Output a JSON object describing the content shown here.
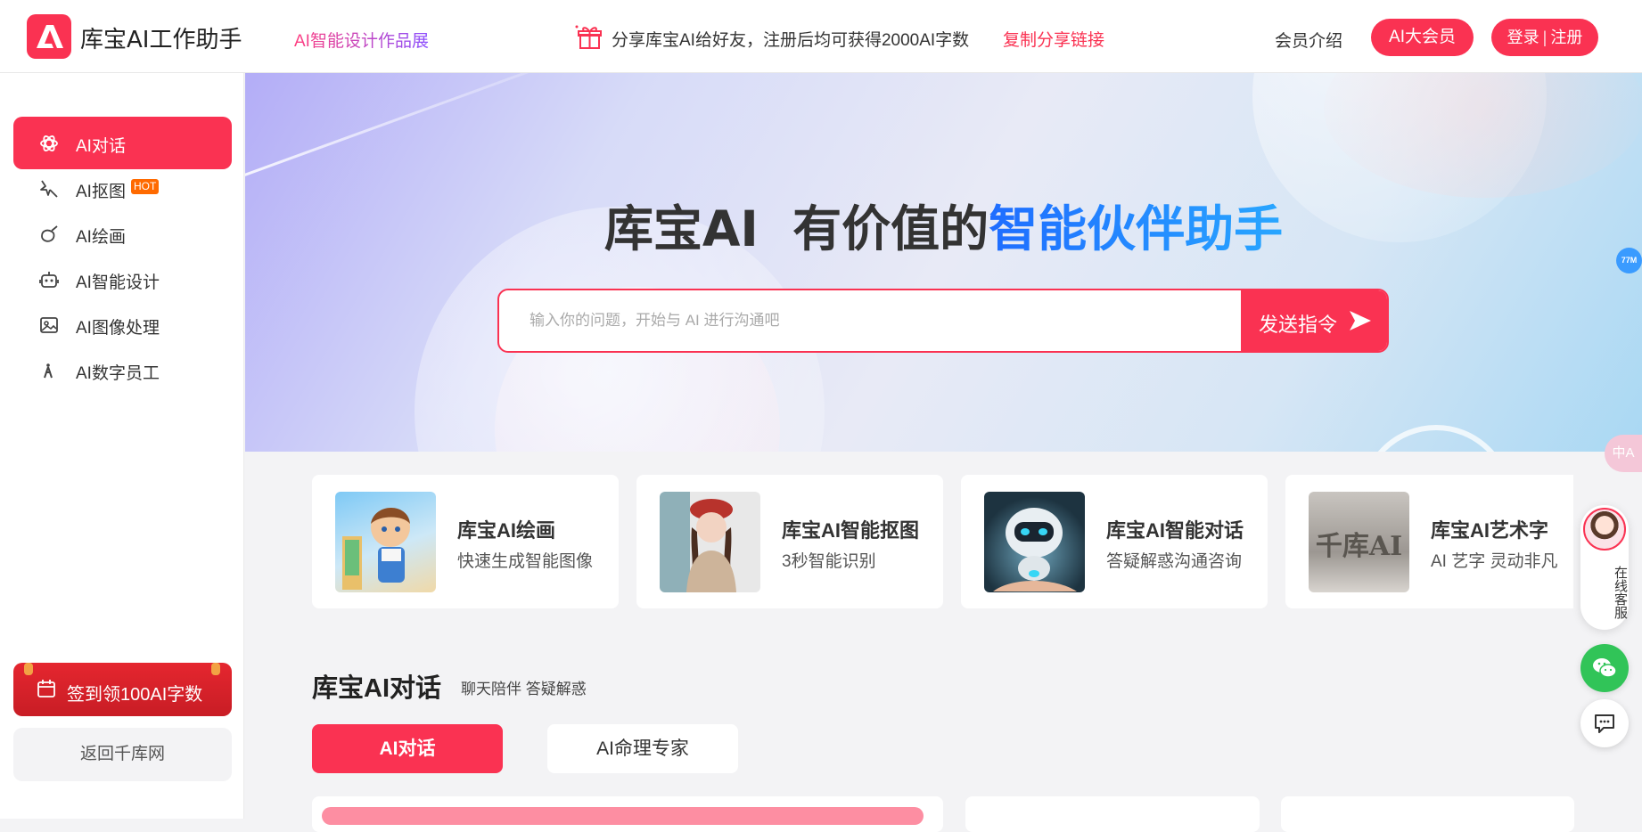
{
  "header": {
    "logo_text": "库宝AI工作助手",
    "gallery_link": "AI智能设计作品展",
    "share_text": "分享库宝AI给好友，注册后均可获得2000AI字数",
    "share_link": "复制分享链接",
    "member_link": "会员介绍",
    "vip_button": "AI大会员",
    "login": "登录",
    "register": "注册",
    "login_separator": "|"
  },
  "sidebar": {
    "items": [
      {
        "label": "AI对话",
        "icon": "ai-chat-icon",
        "active": true
      },
      {
        "label": "AI抠图",
        "icon": "magic-wand-icon",
        "badge": "HOT"
      },
      {
        "label": "AI绘画",
        "icon": "palette-icon"
      },
      {
        "label": "AI智能设计",
        "icon": "robot-icon"
      },
      {
        "label": "AI图像处理",
        "icon": "image-icon"
      },
      {
        "label": "AI数字员工",
        "icon": "person-icon"
      }
    ],
    "signin_button": "签到领100AI字数",
    "back_button": "返回千库网"
  },
  "hero": {
    "title_prefix": "库宝AI  有价值的",
    "title_accent": "智能伙伴助手",
    "search_placeholder": "输入你的问题，开始与 AI 进行沟通吧",
    "send_button": "发送指令",
    "right_dot": "77M",
    "translate_label": "中A"
  },
  "cards": [
    {
      "title": "库宝AI绘画",
      "desc": "快速生成智能图像"
    },
    {
      "title": "库宝AI智能抠图",
      "desc": "3秒智能识别"
    },
    {
      "title": "库宝AI智能对话",
      "desc": "答疑解惑沟通咨询"
    },
    {
      "title": "库宝AI艺术字",
      "desc": "AI 艺字 灵动非凡",
      "thumb_text": "千库AI"
    }
  ],
  "section": {
    "title": "库宝AI对话",
    "subtitle": "聊天陪伴 答疑解惑",
    "tabs": [
      "AI对话",
      "AI命理专家"
    ]
  },
  "floating": {
    "kefu_label": "在线客服"
  },
  "colors": {
    "brand": "#fa3252",
    "accent_blue": "#1f6dff",
    "wechat": "#31c458"
  }
}
